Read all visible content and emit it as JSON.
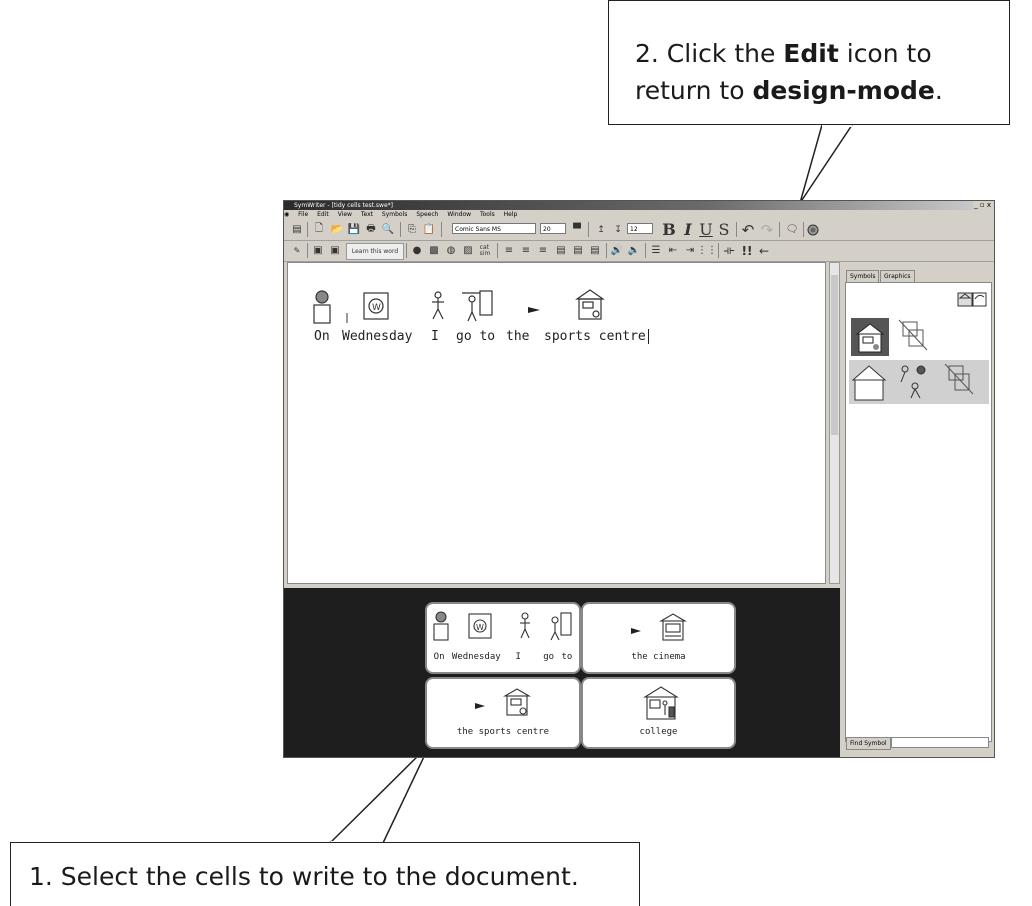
{
  "callouts": {
    "top": {
      "line1_pre": "2. Click the ",
      "line1_bold": "Edit",
      "line1_post": " icon to",
      "line2_pre": "return to ",
      "line2_bold": "design-mode",
      "line2_post": "."
    },
    "bottom": "1. Select the cells to write to the document."
  },
  "app": {
    "title": "SymWriter - [tidy cells test.swe*]",
    "window_controls": "_ ▫ x",
    "menu": [
      "File",
      "Edit",
      "View",
      "Text",
      "Symbols",
      "Speech",
      "Window",
      "Tools",
      "Help"
    ],
    "font_name": "Comic Sans MS",
    "font_size": "20",
    "line_spacing": "12",
    "format_buttons": {
      "bold": "B",
      "italic": "I",
      "underline": "U",
      "strike": "S"
    },
    "learn_word": "Learn this word",
    "cat_sim": "cat\nsim",
    "document": {
      "words": [
        "On",
        "Wednesday",
        "I",
        "go to",
        "the",
        "sports centre"
      ]
    },
    "grid": {
      "cells": [
        {
          "words": [
            "On",
            "Wednesday",
            "I",
            "go to"
          ]
        },
        {
          "caption": "the cinema"
        },
        {
          "caption": "the sports centre"
        },
        {
          "caption": "college"
        }
      ]
    },
    "side": {
      "tabs": [
        "Symbols",
        "Graphics"
      ],
      "find_button": "Find Symbol",
      "find_value": ""
    }
  }
}
